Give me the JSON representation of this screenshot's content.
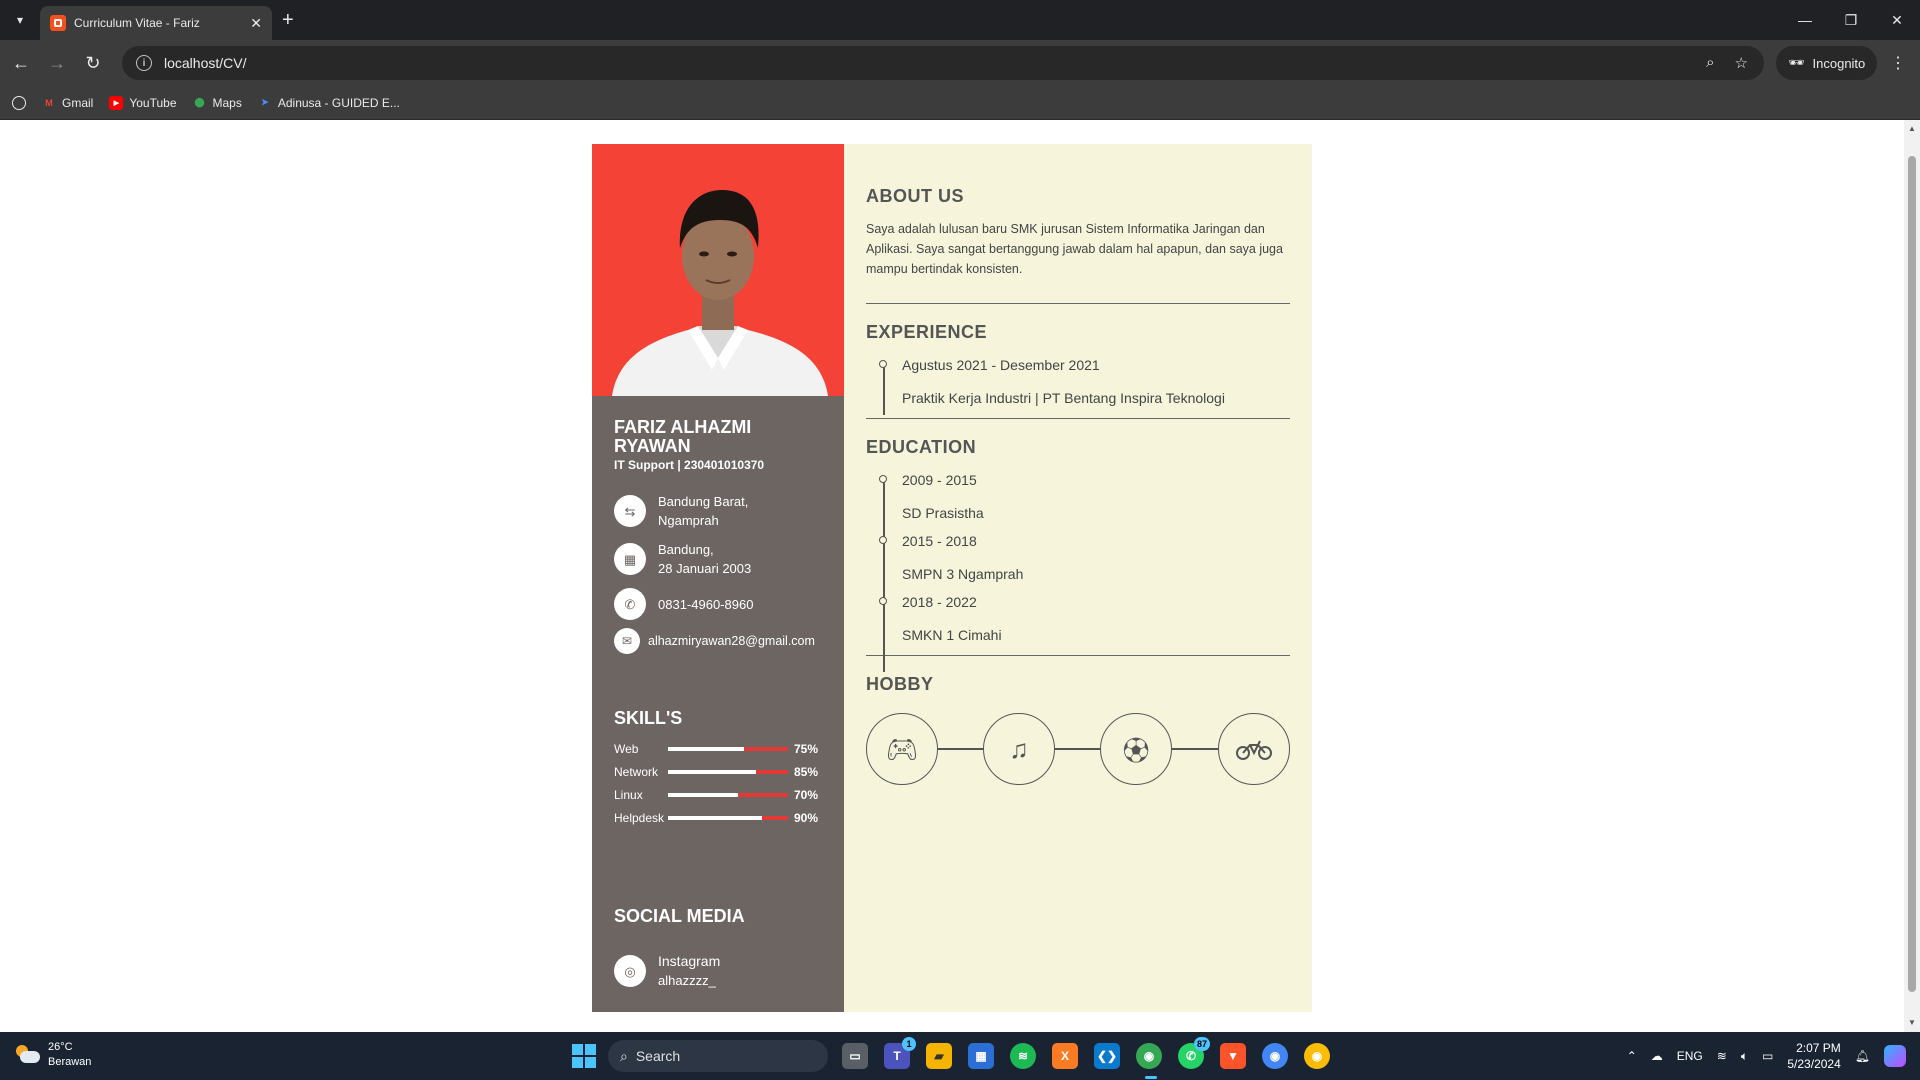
{
  "browser": {
    "tab_title": "Curriculum Vitae - Fariz",
    "url": "localhost/CV/",
    "incognito_label": "Incognito",
    "bookmarks": [
      "Gmail",
      "YouTube",
      "Maps",
      "Adinusa - GUIDED E..."
    ]
  },
  "profile": {
    "name": "FARIZ ALHAZMI RYAWAN",
    "role": "IT Support | 230401010370",
    "address_line1": "Bandung Barat,",
    "address_line2": "Ngamprah",
    "birth_line1": "Bandung,",
    "birth_line2": "28 Januari 2003",
    "phone": "0831-4960-8960",
    "email": "alhazmiryawan28@gmail.com"
  },
  "skills": {
    "title": "SKILL'S",
    "items": [
      {
        "name": "Web",
        "percent_label": "75%",
        "level": 0.75
      },
      {
        "name": "Network",
        "percent_label": "85%",
        "level": 0.85
      },
      {
        "name": "Linux",
        "percent_label": "70%",
        "level": 0.7
      },
      {
        "name": "Helpdesk",
        "percent_label": "90%",
        "level": 0.9
      }
    ]
  },
  "social": {
    "title": "SOCIAL MEDIA",
    "platform": "Instagram",
    "handle": "alhazzzz_"
  },
  "about": {
    "title": "ABOUT US",
    "text": "Saya adalah lulusan baru SMK jurusan Sistem Informatika Jaringan dan Aplikasi. Saya sangat bertanggung jawab dalam hal apapun, dan saya juga mampu bertindak konsisten."
  },
  "experience": {
    "title": "EXPERIENCE",
    "items": [
      {
        "date": "Agustus 2021 - Desember 2021",
        "desc": "Praktik Kerja Industri | PT Bentang Inspira Teknologi"
      }
    ]
  },
  "education": {
    "title": "EDUCATION",
    "items": [
      {
        "date": "2009 - 2015",
        "desc": "SD Prasistha"
      },
      {
        "date": "2015 - 2018",
        "desc": "SMPN 3 Ngamprah"
      },
      {
        "date": "2018 - 2022",
        "desc": "SMKN 1 Cimahi"
      }
    ]
  },
  "hobby": {
    "title": "HOBBY",
    "icons": [
      "gamepad-icon",
      "music-icon",
      "soccer-ball-icon",
      "motorcycle-icon"
    ]
  },
  "taskbar": {
    "temperature": "26°C",
    "weather": "Berawan",
    "search_placeholder": "Search",
    "language": "ENG",
    "time": "2:07 PM",
    "date": "5/23/2024",
    "teams_badge": "1",
    "whatsapp_badge": "87"
  },
  "colors": {
    "sidebar": "#6c6561",
    "photo_bg": "#f44336",
    "content_bg": "#f6f5dc",
    "skill_accent": "#e53935"
  }
}
